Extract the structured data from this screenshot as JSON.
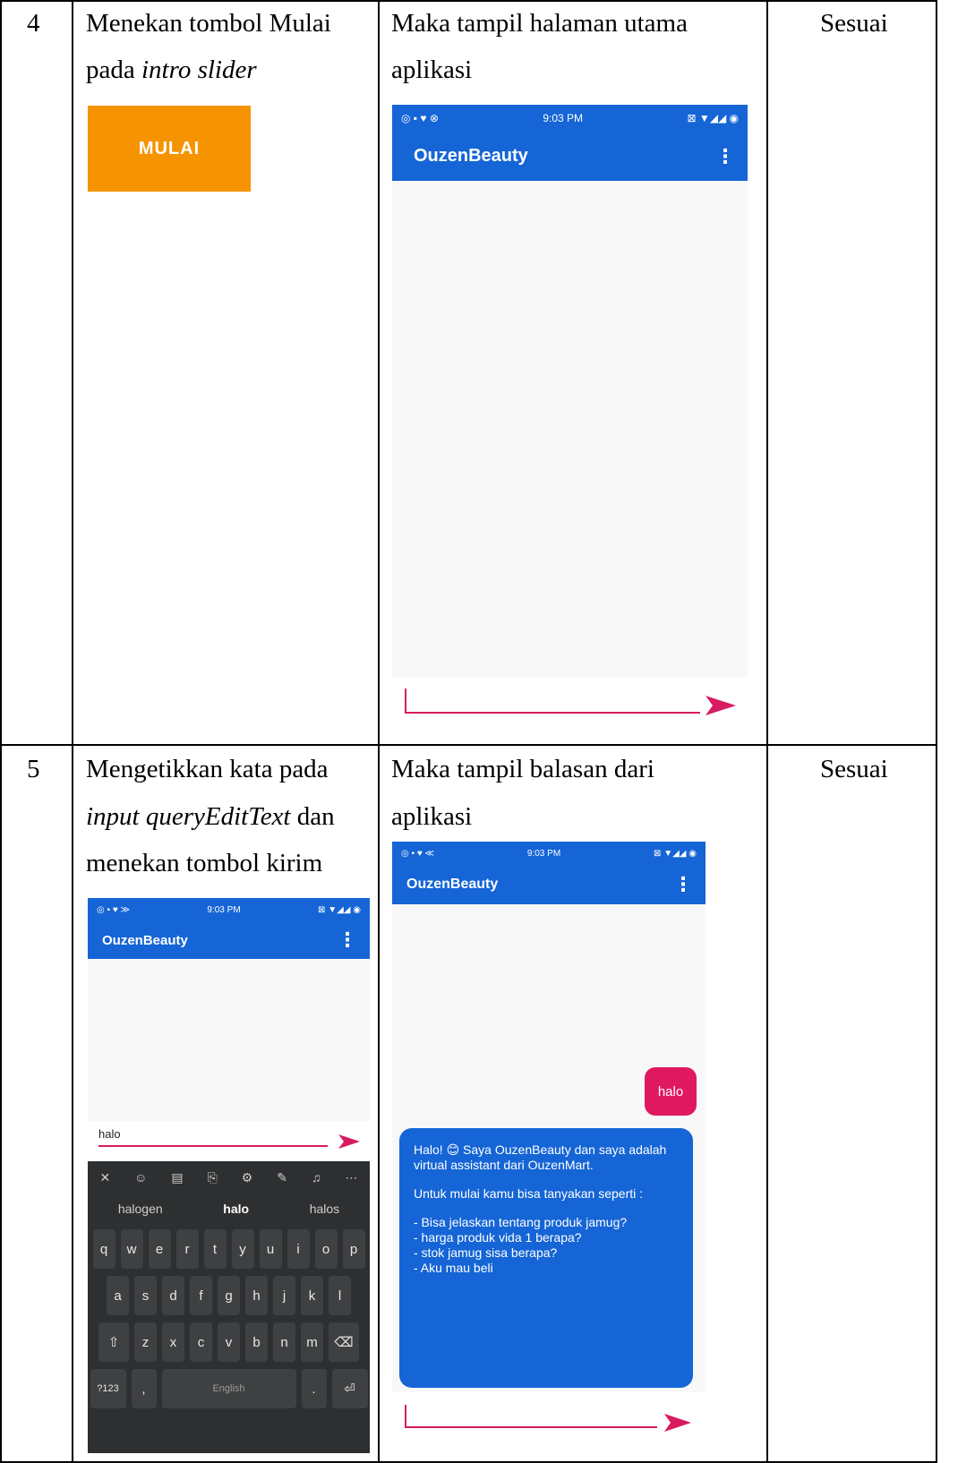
{
  "rows": [
    {
      "number": "4",
      "step_line1": "Menekan tombol Mulai",
      "step_line2_prefix": "pada ",
      "step_line2_italic": "intro slider",
      "button_label": "MULAI",
      "result_line1": "Maka tampil halaman utama",
      "result_line2": "aplikasi",
      "status": "Sesuai",
      "screen": {
        "app_title": "OuzenBeauty",
        "time": "9:03 PM",
        "menu": "⋮"
      }
    },
    {
      "number": "5",
      "step_line1": "Mengetikkan kata pada",
      "step_line2_italic": "input queryEditText",
      "step_line2_suffix": " dan",
      "step_line3": "menekan tombol kirim",
      "result_line1": "Maka tampil balasan dari",
      "result_line2": "aplikasi",
      "status": "Sesuai",
      "input_screen": {
        "app_title": "OuzenBeauty",
        "time": "9:03 PM",
        "menu": "⋮",
        "typed_text": "halo",
        "suggestions": [
          "halogen",
          "halo",
          "halos"
        ],
        "keyboard_rows": [
          [
            "q",
            "w",
            "e",
            "r",
            "t",
            "y",
            "u",
            "i",
            "o",
            "p"
          ],
          [
            "a",
            "s",
            "d",
            "f",
            "g",
            "h",
            "j",
            "k",
            "l"
          ],
          [
            "z",
            "x",
            "c",
            "v",
            "b",
            "n",
            "m"
          ]
        ],
        "space_label": "English"
      },
      "reply_screen": {
        "app_title": "OuzenBeauty",
        "time": "9:03 PM",
        "menu": "⋮",
        "user_message": "halo",
        "bot_paragraph1": "Halo! 😊 Saya OuzenBeauty dan saya adalah virtual assistant dari OuzenMart.",
        "bot_paragraph2": "Untuk mulai kamu bisa tanyakan seperti :",
        "bot_paragraph3": "- Bisa jelaskan tentang produk jamug?\n- harga produk vida 1 berapa?\n- stok jamug sisa berapa?\n- Aku mau beli"
      }
    }
  ],
  "colors": {
    "primary": "#1565d6",
    "accent": "#d81b60",
    "mulai": "#f59300"
  }
}
